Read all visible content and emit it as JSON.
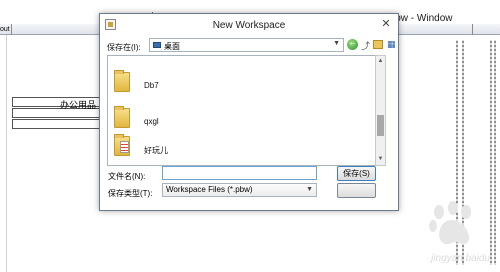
{
  "background_window": {
    "title": "w_dw古 (ex) (D:\\PBWorkspace\\xct\\ex.pbl) inherited from window - Window",
    "toolbar_left_text": "out",
    "table_label": "办公用品"
  },
  "dialog": {
    "title": "New Workspace",
    "close_glyph": "✕",
    "look_in_label": "保存在(I):",
    "look_in_value": "桌面",
    "files": [
      {
        "name": "Db7",
        "icon": "folder-icon"
      },
      {
        "name": "qxgl",
        "icon": "folder-icon"
      },
      {
        "name": "好玩儿",
        "icon": "folder-docs-icon"
      }
    ],
    "file_name_label": "文件名(N):",
    "file_name_value": "",
    "file_type_label": "保存类型(T):",
    "file_type_value": "Workspace Files (*.pbw)",
    "save_button": "保存(S)",
    "cancel_button": ""
  },
  "watermark": "jingyan.baidu"
}
